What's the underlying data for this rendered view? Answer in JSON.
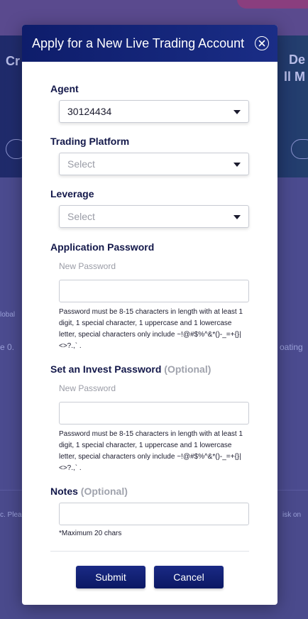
{
  "background": {
    "banner_left": "Cr",
    "banner_right_line1": "De",
    "banner_right_line2": "ll M",
    "frag_left1": "lobal",
    "frag_left2": "e  0.",
    "frag_right": "oating",
    "frag_foot_left": "c. Plea",
    "frag_foot_right": "isk on"
  },
  "modal": {
    "title": "Apply for a New Live Trading Account",
    "agent": {
      "label": "Agent",
      "value": "30124434"
    },
    "trading_platform": {
      "label": "Trading Platform",
      "value": "Select"
    },
    "leverage": {
      "label": "Leverage",
      "value": "Select"
    },
    "application_password": {
      "label": "Application Password",
      "sublabel": "New Password",
      "value": "",
      "hint": "Password must be 8-15 characters in length with at least 1 digit, 1 special character, 1 uppercase and 1 lowercase letter, special characters only include ~!@#$%^&*()-_=+{}|<>?.,` ."
    },
    "invest_password": {
      "label": "Set an Invest Password",
      "optional": "(Optional)",
      "sublabel": "New Password",
      "value": "",
      "hint": "Password must be 8-15 characters in length with at least 1 digit, 1 special character, 1 uppercase and 1 lowercase letter, special characters only include ~!@#$%^&*()-_=+{}|<>?.,` ."
    },
    "notes": {
      "label": "Notes",
      "optional": "(Optional)",
      "value": "",
      "hint": "*Maximum 20 chars"
    },
    "submit_label": "Submit",
    "cancel_label": "Cancel"
  },
  "colors": {
    "header": "#0e1d6b",
    "button": "#0b1863",
    "label": "#13184a",
    "optional": "#a0a3ad",
    "overlay": "#4a4a8a"
  }
}
